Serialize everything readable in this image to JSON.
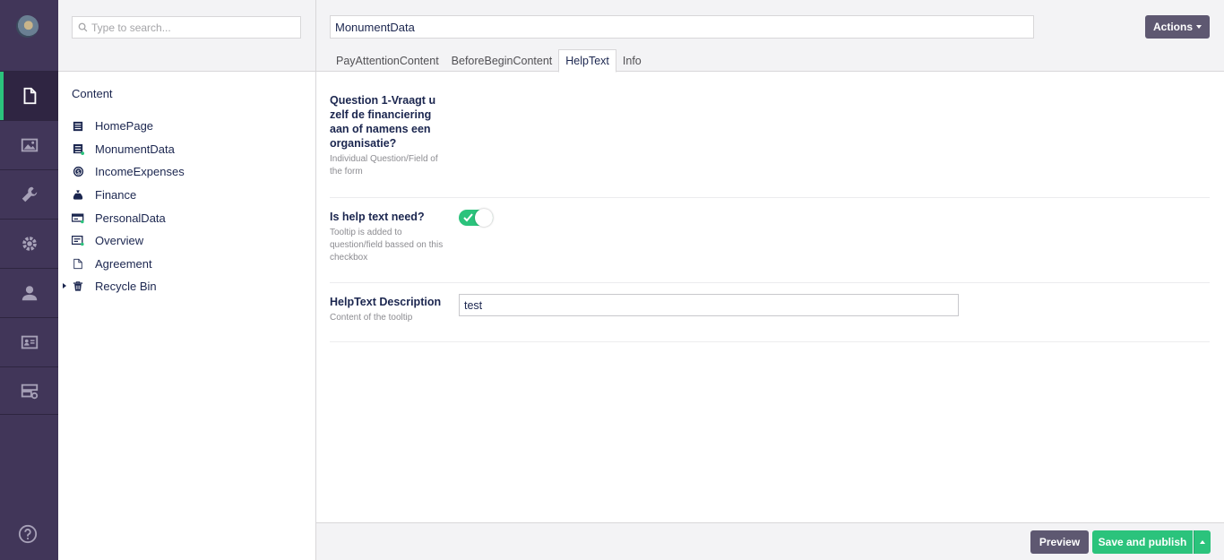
{
  "search": {
    "placeholder": "Type to search..."
  },
  "tree": {
    "title": "Content",
    "items": [
      {
        "label": "HomePage",
        "icon": "document-list-icon"
      },
      {
        "label": "MonumentData",
        "icon": "document-list-new-icon"
      },
      {
        "label": "IncomeExpenses",
        "icon": "coin-icon"
      },
      {
        "label": "Finance",
        "icon": "money-bag-icon"
      },
      {
        "label": "PersonalData",
        "icon": "id-card-icon"
      },
      {
        "label": "Overview",
        "icon": "overview-icon"
      },
      {
        "label": "Agreement",
        "icon": "blank-document-icon"
      },
      {
        "label": "Recycle Bin",
        "icon": "trash-icon"
      }
    ]
  },
  "editor": {
    "name_value": "MonumentData",
    "actions_label": "Actions",
    "tabs": [
      "PayAttentionContent",
      "BeforeBeginContent",
      "HelpText",
      "Info"
    ],
    "active_tab": "HelpText",
    "properties": [
      {
        "label": "Question 1-Vraagt u zelf de financiering aan of namens een organisatie?",
        "description": "Individual Question/Field of the form"
      },
      {
        "label": "Is help text need?",
        "description": "Tooltip is added to question/field bassed on this checkbox",
        "toggle_on": true
      },
      {
        "label": "HelpText Description",
        "description": "Content of the tooltip",
        "value": "test"
      }
    ],
    "preview_label": "Preview",
    "publish_label": "Save and publish"
  },
  "colors": {
    "rail": "#413659",
    "accent": "#2bc37c",
    "button": "#5e5871"
  }
}
